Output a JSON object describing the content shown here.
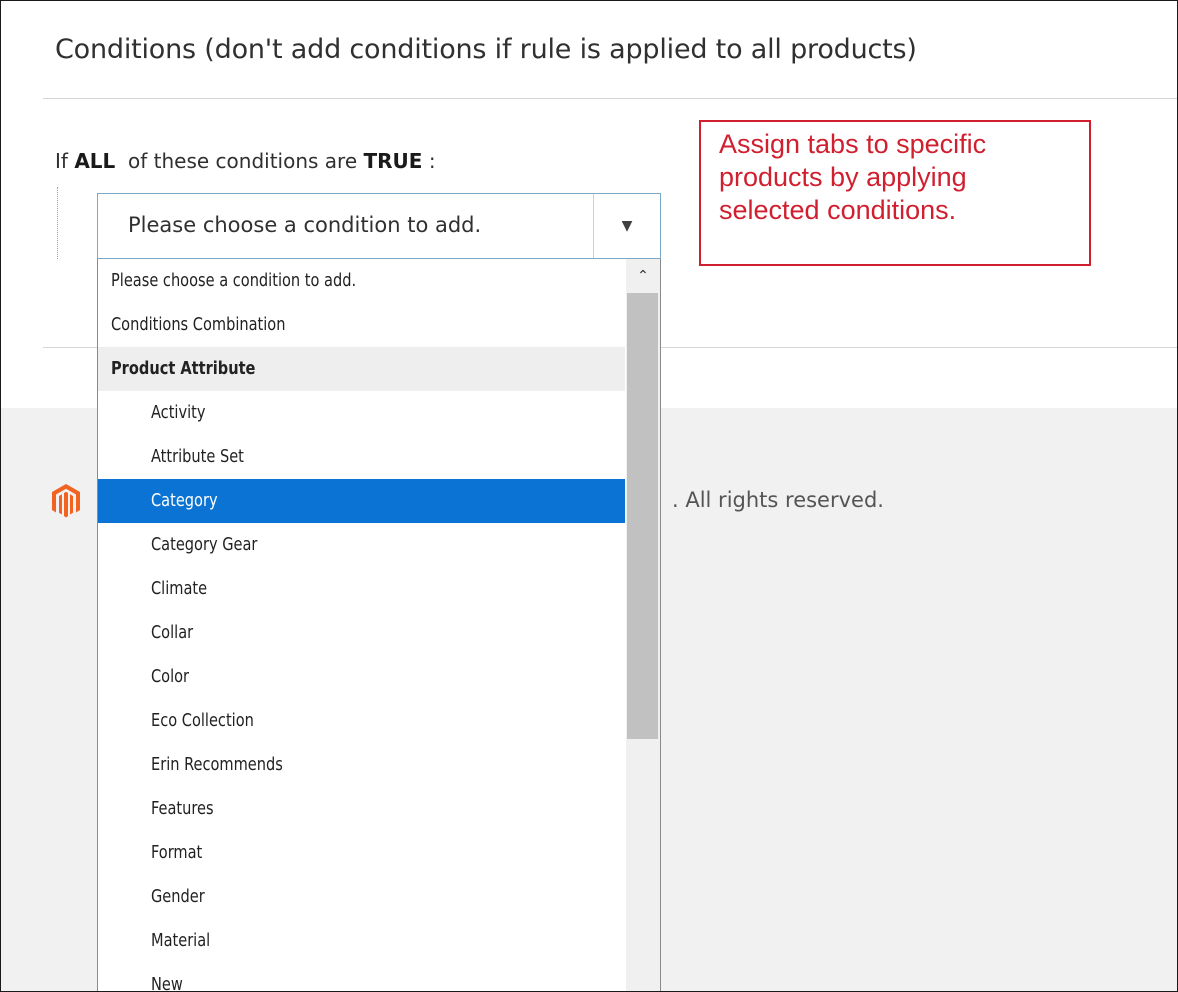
{
  "section": {
    "title": "Conditions (don't add conditions if rule is applied to all products)"
  },
  "condition_line": {
    "prefix": "If",
    "aggregator": "ALL",
    "middle": "of these conditions are",
    "value": "TRUE",
    "suffix": ":"
  },
  "select": {
    "value": "Please choose a condition to add.",
    "arrow_icon": "caret-down"
  },
  "annotation": {
    "text": "Assign tabs to specific products by applying selected conditions.",
    "color": "#d01f2e"
  },
  "dropdown": {
    "options": [
      {
        "label": "Please choose a condition to add.",
        "kind": "top"
      },
      {
        "label": "Conditions Combination",
        "kind": "top"
      },
      {
        "label": "Product Attribute",
        "kind": "group"
      },
      {
        "label": "Activity",
        "kind": "child"
      },
      {
        "label": "Attribute Set",
        "kind": "child"
      },
      {
        "label": "Category",
        "kind": "child",
        "selected": true
      },
      {
        "label": "Category Gear",
        "kind": "child"
      },
      {
        "label": "Climate",
        "kind": "child"
      },
      {
        "label": "Collar",
        "kind": "child"
      },
      {
        "label": "Color",
        "kind": "child"
      },
      {
        "label": "Eco Collection",
        "kind": "child"
      },
      {
        "label": "Erin Recommends",
        "kind": "child"
      },
      {
        "label": "Features",
        "kind": "child"
      },
      {
        "label": "Format",
        "kind": "child"
      },
      {
        "label": "Gender",
        "kind": "child"
      },
      {
        "label": "Material",
        "kind": "child"
      },
      {
        "label": "New",
        "kind": "child"
      }
    ],
    "selected_color": "#0b73d4"
  },
  "footer": {
    "copyright_visible": ". All rights reserved.",
    "logo_icon": "magento-logo",
    "logo_color": "#f26322"
  }
}
